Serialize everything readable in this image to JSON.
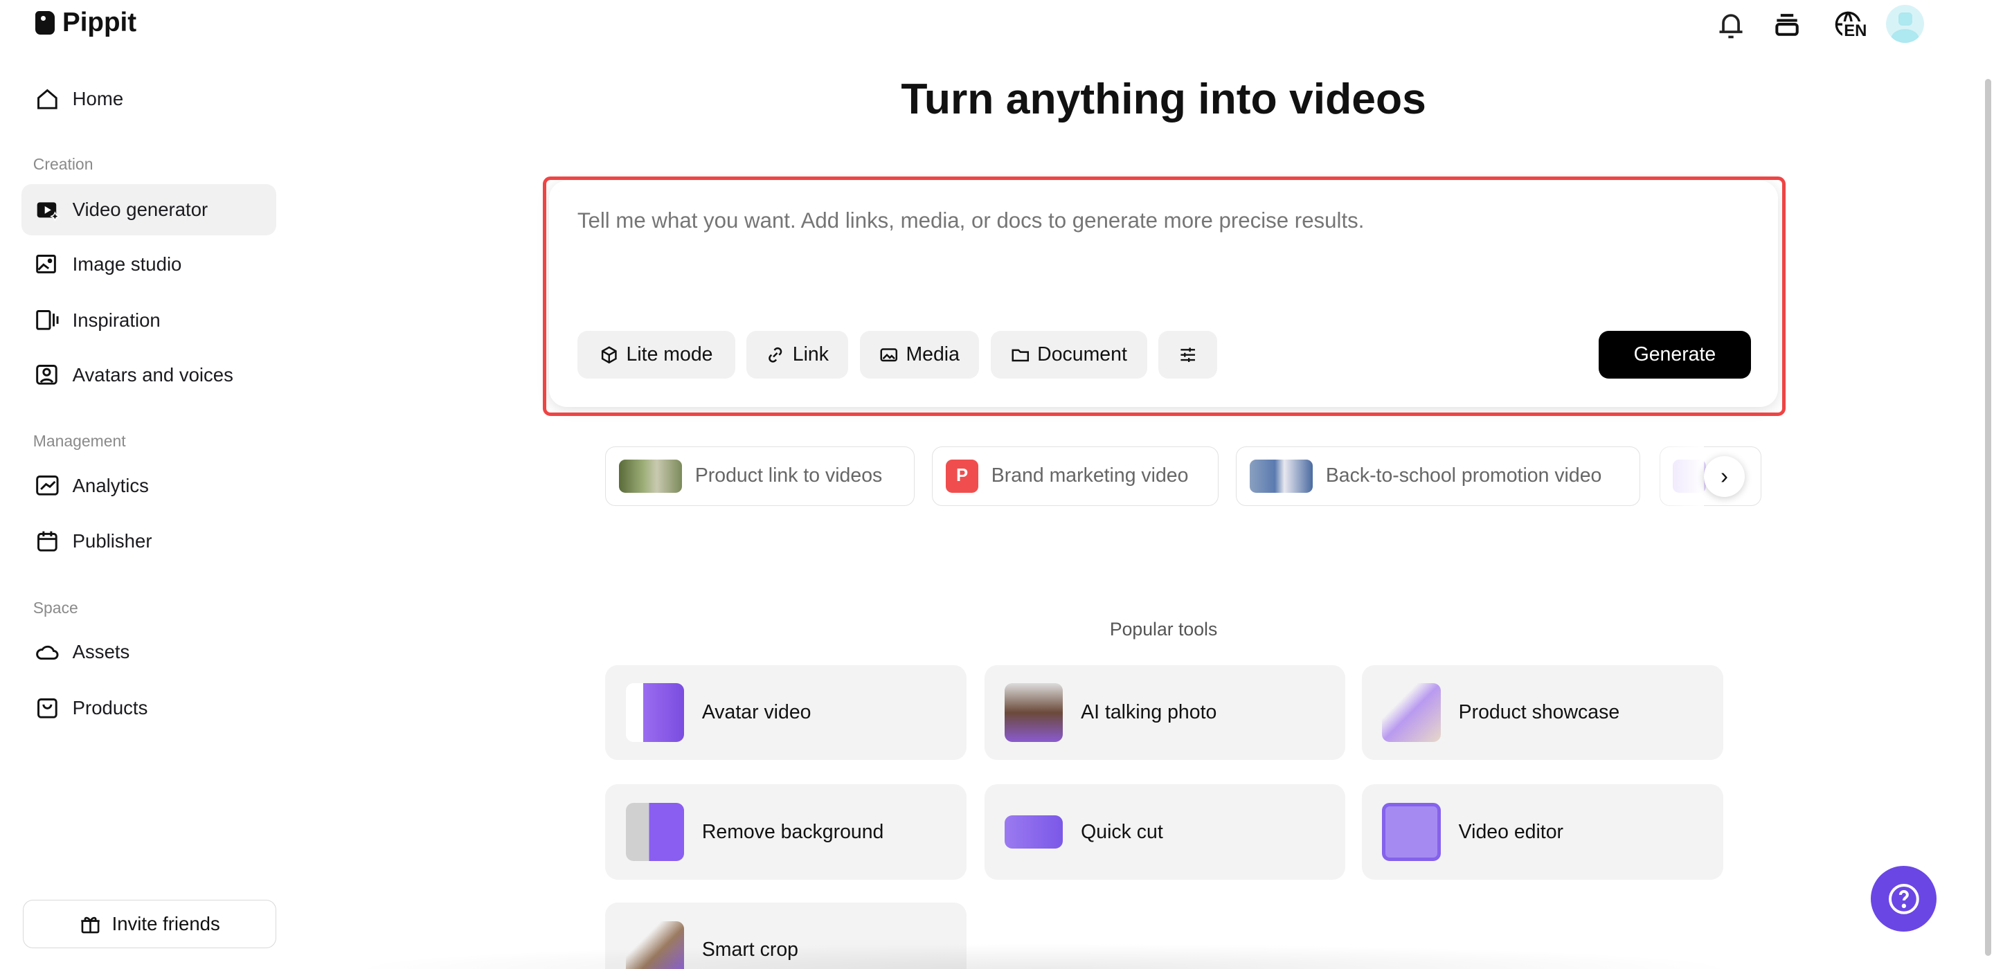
{
  "app": {
    "name": "Pippit"
  },
  "sidebar": {
    "home": "Home",
    "sections": {
      "creation": "Creation",
      "management": "Management",
      "space": "Space"
    },
    "items": {
      "video_generator": "Video generator",
      "image_studio": "Image studio",
      "inspiration": "Inspiration",
      "avatars": "Avatars and voices",
      "analytics": "Analytics",
      "publisher": "Publisher",
      "assets": "Assets",
      "products": "Products"
    },
    "invite": "Invite friends"
  },
  "header": {
    "language": "EN"
  },
  "main": {
    "title": "Turn anything into videos",
    "prompt": {
      "placeholder": "Tell me what you want. Add links, media, or docs to generate more precise results.",
      "value": ""
    },
    "buttons": {
      "lite": "Lite mode",
      "link": "Link",
      "media": "Media",
      "document": "Document",
      "generate": "Generate"
    },
    "chips": [
      "Product link to videos",
      "Brand marketing video",
      "Back-to-school promotion video"
    ],
    "chip_badge": "P",
    "popular_title": "Popular tools",
    "tools": [
      "Avatar video",
      "AI talking photo",
      "Product showcase",
      "Remove background",
      "Quick cut",
      "Video editor",
      "Smart crop"
    ]
  },
  "colors": {
    "accent": "#6a46e5",
    "highlight": "#ef4444",
    "badge": "#f04e4e"
  }
}
